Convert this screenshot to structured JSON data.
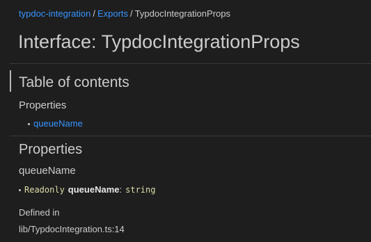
{
  "breadcrumb": {
    "items": [
      {
        "label": "typdoc-integration"
      },
      {
        "label": "Exports"
      }
    ],
    "separator": "/",
    "current": "TypdocIntegrationProps"
  },
  "page": {
    "title": "Interface: TypdocIntegrationProps"
  },
  "toc": {
    "title": "Table of contents",
    "group_title": "Properties",
    "items": [
      {
        "label": "queueName"
      }
    ]
  },
  "properties": {
    "section_title": "Properties",
    "member": {
      "name": "queueName",
      "signature": {
        "keyword": "Readonly",
        "name": "queueName",
        "colon": ":",
        "type": "string"
      },
      "defined_in_label": "Defined in",
      "defined_in_value": "lib/TypdocIntegration.ts:14"
    }
  },
  "colors": {
    "background": "#1e1e1e",
    "text": "#cccccc",
    "link": "#3794ff",
    "code": "#dcdcaa"
  }
}
